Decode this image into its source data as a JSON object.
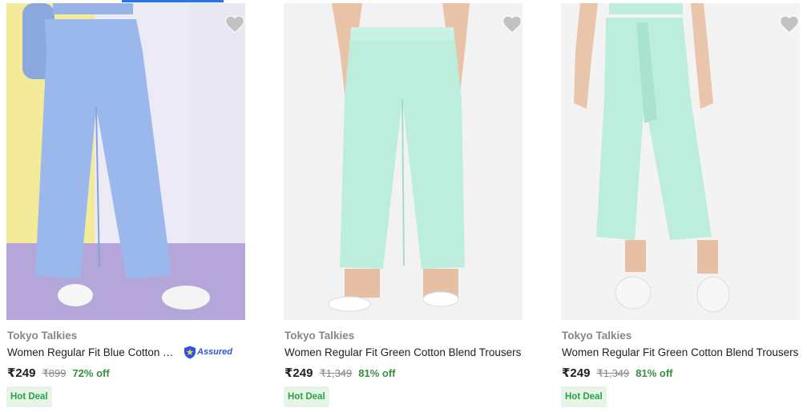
{
  "wishlist_icon": "heart-icon",
  "colors": {
    "brand_text": "#878787",
    "price_text": "#212121",
    "discount_text": "#388e3c",
    "deal_bg": "#e6f5e7",
    "deal_text": "#26a541",
    "assured_blue": "#2a55e5"
  },
  "products": [
    {
      "brand": "Tokyo Talkies",
      "title": "Women Regular Fit Blue Cotton Trousers",
      "assured_label": "Assured",
      "price": "₹249",
      "mrp": "₹899",
      "discount": "72% off",
      "deal": "Hot Deal"
    },
    {
      "brand": "Tokyo Talkies",
      "title": "Women Regular Fit Green Cotton Blend Trousers",
      "price": "₹249",
      "mrp": "₹1,349",
      "discount": "81% off",
      "deal": "Hot Deal"
    },
    {
      "brand": "Tokyo Talkies",
      "title": "Women Regular Fit Green Cotton Blend Trousers",
      "price": "₹249",
      "mrp": "₹1,349",
      "discount": "81% off",
      "deal": "Hot Deal"
    }
  ]
}
